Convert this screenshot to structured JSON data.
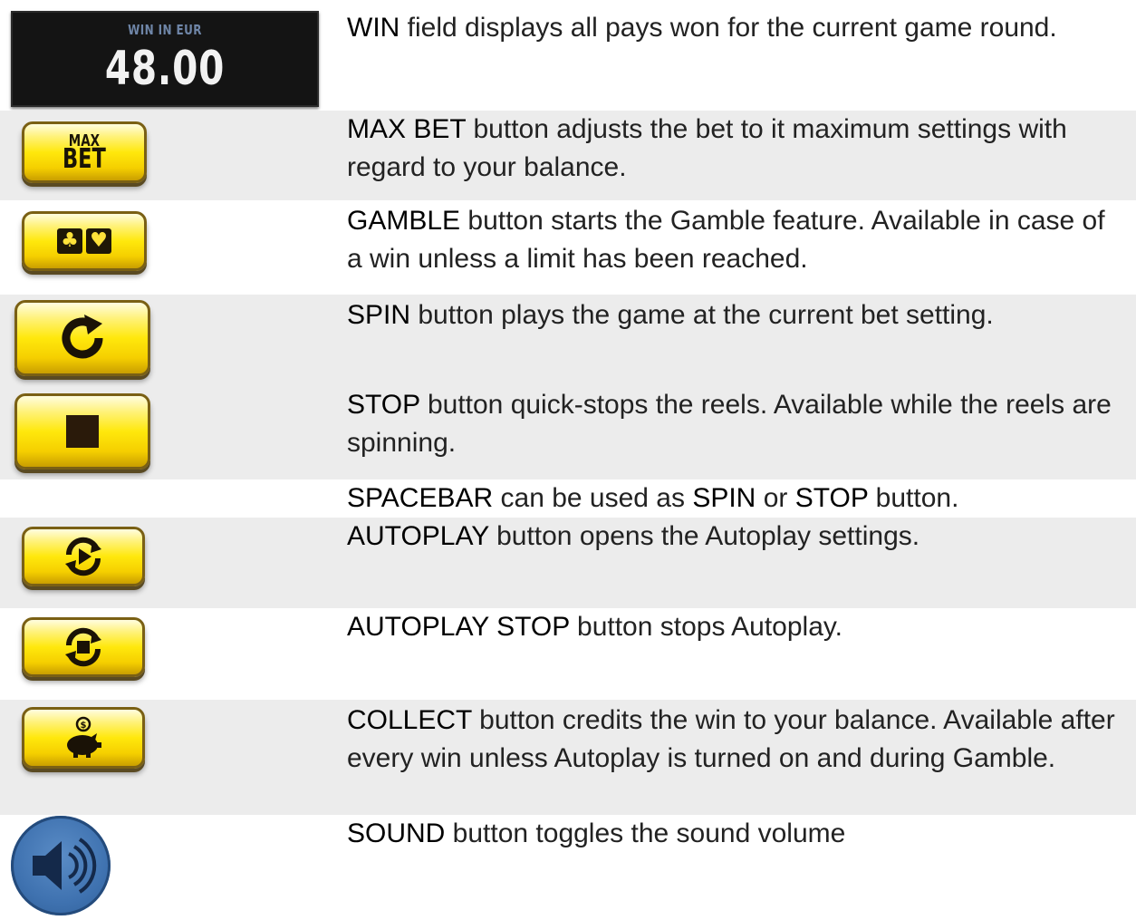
{
  "win_field": {
    "label": "WIN IN EUR",
    "amount": "48.00"
  },
  "icons": {
    "max_bet": {
      "line1": "MAX",
      "line2": "BET"
    },
    "gamble": {
      "left": "♣",
      "right": "♥"
    }
  },
  "rows": [
    {
      "id": "win",
      "keyword": "WIN",
      "text": " field displays all pays won for the current game round."
    },
    {
      "id": "max_bet",
      "keyword": "MAX BET",
      "text": " button adjusts the bet to it maximum settings with regard to your balance."
    },
    {
      "id": "gamble",
      "keyword": "GAMBLE",
      "text": " button starts the Gamble feature. Available in case of a win unless a limit has been reached."
    },
    {
      "id": "spin",
      "keyword": "SPIN",
      "text": " button plays the game at the current bet setting."
    },
    {
      "id": "stop",
      "keyword": "STOP",
      "text": " button quick-stops the reels. Available while the reels are spinning."
    },
    {
      "id": "spacebar",
      "keyword": "SPACEBAR",
      "text_a": " can be used as ",
      "keyword2": "SPIN",
      "text_b": " or ",
      "keyword3": "STOP",
      "text_c": " button."
    },
    {
      "id": "autoplay",
      "keyword": "AUTOPLAY",
      "text": " button opens the Autoplay settings."
    },
    {
      "id": "autoplay_stop",
      "keyword": "AUTOPLAY STOP",
      "text": " button stops Autoplay."
    },
    {
      "id": "collect",
      "keyword": "COLLECT",
      "text": " button credits the win to your balance. Available after every win unless Autoplay is turned on and during Gamble."
    },
    {
      "id": "sound",
      "keyword": "SOUND",
      "text": " button toggles the sound volume"
    }
  ],
  "icon_names": [
    "win-field",
    "max-bet-button",
    "gamble-cards-icon",
    "spin-refresh-icon",
    "stop-square-icon",
    "autoplay-play-icon",
    "autoplay-stop-icon",
    "piggy-bank-coin-icon",
    "speaker-volume-icon"
  ],
  "colors": {
    "gold": "#ffe80c",
    "row_shade": "#ececec",
    "sound_blue": "#3f72b0",
    "win_bg": "#141414"
  }
}
